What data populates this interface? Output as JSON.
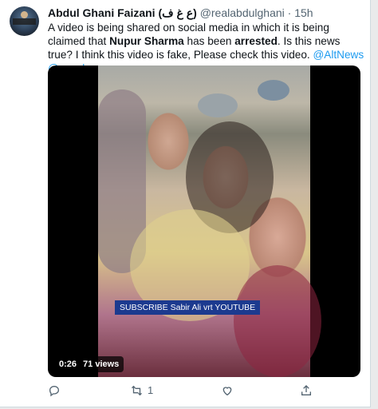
{
  "tweet": {
    "author_name": "Abdul Ghani Faizani (ع غ ف)",
    "handle": "@realabdulghani",
    "separator": "·",
    "time": "15h",
    "text_part1": "A video is being shared on social media in which it is being claimed that ",
    "text_bold1": "Nupur Sharma",
    "text_part2": " has been ",
    "text_bold2": "arrested",
    "text_part3": ". Is this news true?  I think this video is fake, Please check this video. ",
    "mention1": "@AltNews",
    "mention2": "@zoo_bear"
  },
  "video": {
    "overlay_caption": "SUBSCRIBE Sabir Ali vrt YOUTUBE",
    "duration": "0:26",
    "views": "71 views"
  },
  "actions": {
    "icons": [
      "reply-icon",
      "retweet-icon",
      "like-icon",
      "share-icon"
    ],
    "retweet_count": "1"
  },
  "colors": {
    "link": "#1d9bf0",
    "text": "#0f1419",
    "muted": "#536471"
  }
}
